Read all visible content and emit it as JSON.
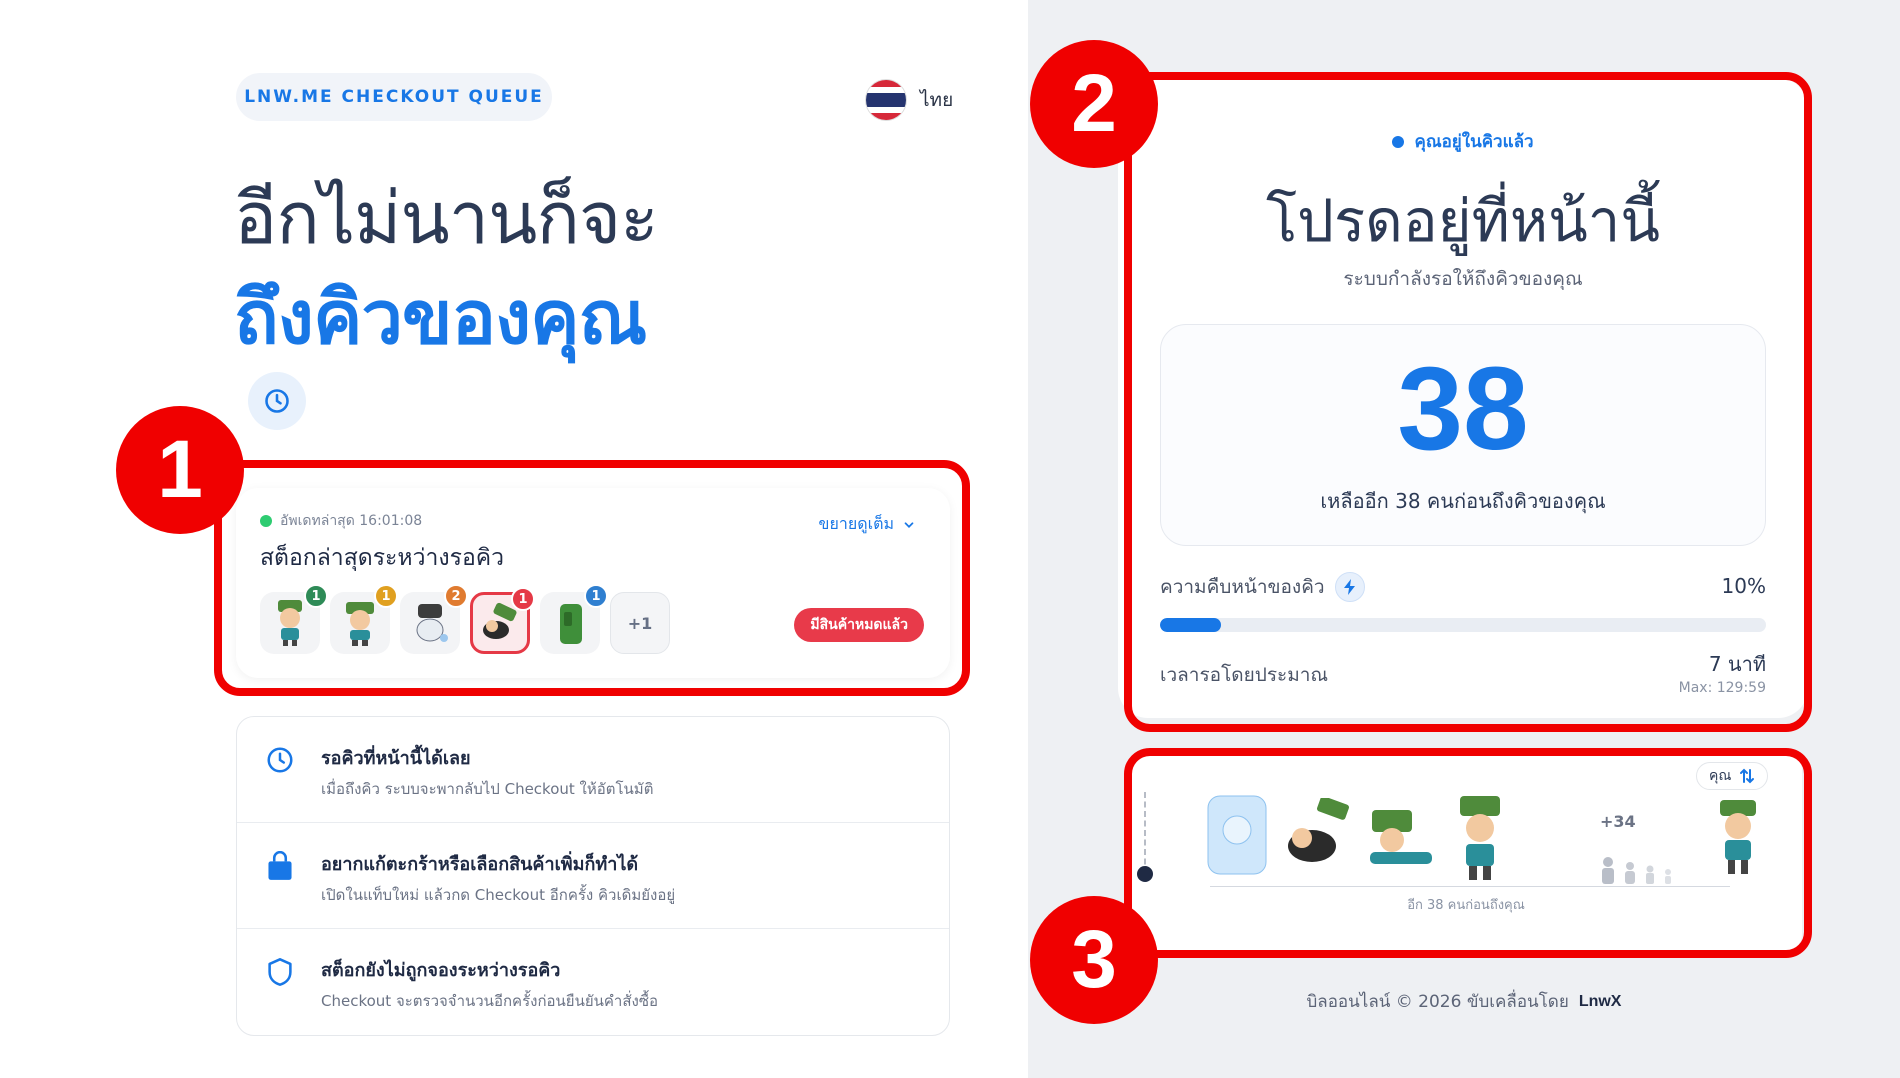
{
  "brand_pill": "LNW.ME CHECKOUT QUEUE",
  "language": "ไทย",
  "headline_line1": "อีกไม่นานก็จะ",
  "headline_line2": "ถึงคิวของคุณ",
  "stock": {
    "updated": "อัพเดทล่าสุด 16:01:08",
    "title": "สต็อกล่าสุดระหว่างรอคิว",
    "expand": "ขยายดูเต็ม",
    "items": [
      {
        "count": "1",
        "badge_color": "#2e8b57"
      },
      {
        "count": "1",
        "badge_color": "#e0a020"
      },
      {
        "count": "2",
        "badge_color": "#e07b30"
      },
      {
        "count": "1",
        "badge_color": "#e53946"
      },
      {
        "count": "1",
        "badge_color": "#2f7fd0"
      }
    ],
    "more": "+1",
    "soldout": "มีสินค้าหมดแล้ว"
  },
  "info": [
    {
      "title": "รอคิวที่หน้านี้ได้เลย",
      "sub": "เมื่อถึงคิว ระบบจะพากลับไป Checkout ให้อัตโนมัติ",
      "icon": "clock-icon"
    },
    {
      "title": "อยากแก้ตะกร้าหรือเลือกสินค้าเพิ่มก็ทำได้",
      "sub": "เปิดในแท็บใหม่ แล้วกด Checkout อีกครั้ง คิวเดิมยังอยู่",
      "icon": "bag-icon"
    },
    {
      "title": "สต็อกยังไม่ถูกจองระหว่างรอคิว",
      "sub": "Checkout จะตรวจจำนวนอีกครั้งก่อนยืนยันคำสั่งซื้อ",
      "icon": "shield-icon"
    }
  ],
  "queue": {
    "status": "คุณอยู่ในคิวแล้ว",
    "title": "โปรดอยู่ที่หน้านี้",
    "subtitle": "ระบบกำลังรอให้ถึงคิวของคุณ",
    "position": "38",
    "position_sub": "เหลืออีก 38 คนก่อนถึงคิวของคุณ",
    "progress_label": "ความคืบหน้าของคิว",
    "progress_pct": "10%",
    "progress_value": 0.1,
    "eta_label": "เวลารอโดยประมาณ",
    "eta_value": "7 นาที",
    "eta_max": "Max: 129:59"
  },
  "track": {
    "you": "คุณ",
    "plus": "+34",
    "ahead": "อีก 38 คนก่อนถึงคุณ"
  },
  "callouts": [
    "1",
    "2",
    "3"
  ],
  "footer_text": "บิลออนไลน์ © 2026 ขับเคลื่อนโดย",
  "footer_logo": "LnwX",
  "colors": {
    "accent": "#1877e6",
    "callout": "#f00000",
    "danger": "#e83a4a"
  }
}
